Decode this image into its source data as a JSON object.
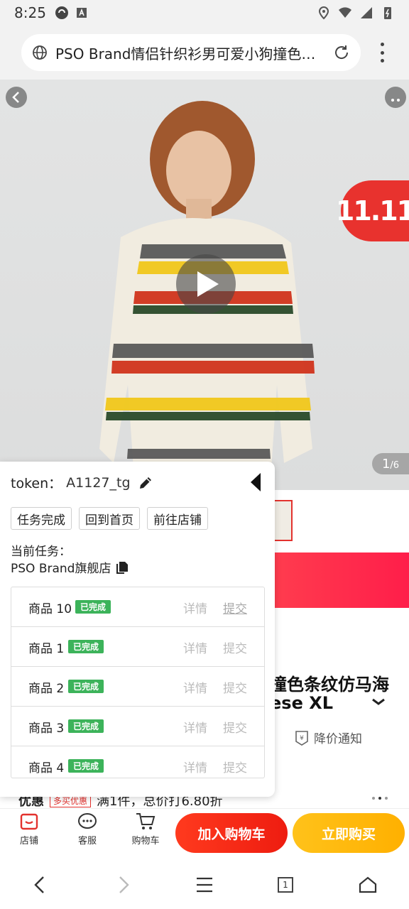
{
  "status_bar": {
    "time": "8:25"
  },
  "url_bar": {
    "url": "PSO Brand情侣针织衫男可爱小狗撞色…"
  },
  "hero": {
    "badge": "11.11",
    "pager_current": "1",
    "pager_total": "/6"
  },
  "product": {
    "title_line1": "撞色条纹仿马海",
    "title_line2": "ese XL",
    "expand_icon": "chevron-down",
    "price_notify": "降价通知"
  },
  "promo": {
    "label": "优惠",
    "tag": "多买优惠",
    "text": "满1件，总价打6.80折"
  },
  "panel": {
    "token_label": "token：",
    "token_value": "A1127_tg",
    "buttons": [
      "任务完成",
      "回到首页",
      "前往店铺"
    ],
    "current_task_label": "当前任务：",
    "current_task_value": "PSO Brand旗舰店",
    "tasks": [
      {
        "name": "商品 10",
        "status": "已完成",
        "detail": "详情",
        "submit": "提交"
      },
      {
        "name": "商品 1",
        "status": "已完成",
        "detail": "详情",
        "submit": "提交"
      },
      {
        "name": "商品 2",
        "status": "已完成",
        "detail": "详情",
        "submit": "提交"
      },
      {
        "name": "商品 3",
        "status": "已完成",
        "detail": "详情",
        "submit": "提交"
      },
      {
        "name": "商品 4",
        "status": "已完成",
        "detail": "详情",
        "submit": "提交"
      }
    ]
  },
  "action_bar": {
    "store": "店铺",
    "service": "客服",
    "cart": "购物车",
    "add_to_cart": "加入购物车",
    "buy_now": "立即购买"
  },
  "browser_nav": {
    "tab_count": "1"
  },
  "colors": {
    "accent_red": "#e3322e",
    "buy_yellow": "#ffb000",
    "done_green": "#3cb35a"
  }
}
